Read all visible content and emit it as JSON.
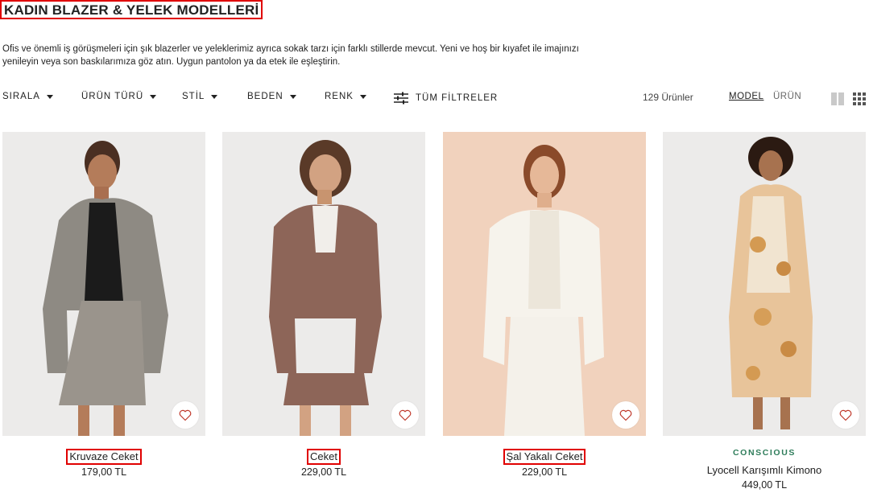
{
  "page": {
    "title": "KADIN BLAZER & YELEK MODELLERİ",
    "intro_line1": "Ofis ve önemli iş görüşmeleri için şık blazerler ve yeleklerimiz ayrıca sokak tarzı için farklı stillerde mevcut. Yeni ve hoş bir kıyafet ile imajınızı",
    "intro_line2": "yenileyin veya son baskılarımıza göz atın. Uygun pantolon ya da etek ile eşleştirin."
  },
  "filters": {
    "sort": "SIRALA",
    "product_type": "ÜRÜN TÜRÜ",
    "style": "STİL",
    "size": "BEDEN",
    "color": "RENK",
    "all_filters": "TÜM FİLTRELER"
  },
  "results": {
    "count": "129 Ürünler",
    "view_model": "MODEL",
    "view_product": "ÜRÜN"
  },
  "products": [
    {
      "name": "Kruvaze Ceket",
      "price": "179,00 TL",
      "tag": "",
      "icon": "heart-icon",
      "highlighted": true
    },
    {
      "name": "Ceket",
      "price": "229,00 TL",
      "tag": "",
      "icon": "heart-icon",
      "highlighted": true
    },
    {
      "name": "Şal Yakalı Ceket",
      "price": "229,00 TL",
      "tag": "",
      "icon": "heart-icon",
      "highlighted": true
    },
    {
      "name": "Lyocell Karışımlı Kimono",
      "price": "449,00 TL",
      "tag": "CONSCIOUS",
      "icon": "heart-icon",
      "highlighted": false
    }
  ],
  "colors": {
    "highlight_border": "#e00000",
    "conscious_tag": "#2f7d5b",
    "image_bg_grey": "#ecebea",
    "image_bg_peach": "#f1d2bd"
  }
}
